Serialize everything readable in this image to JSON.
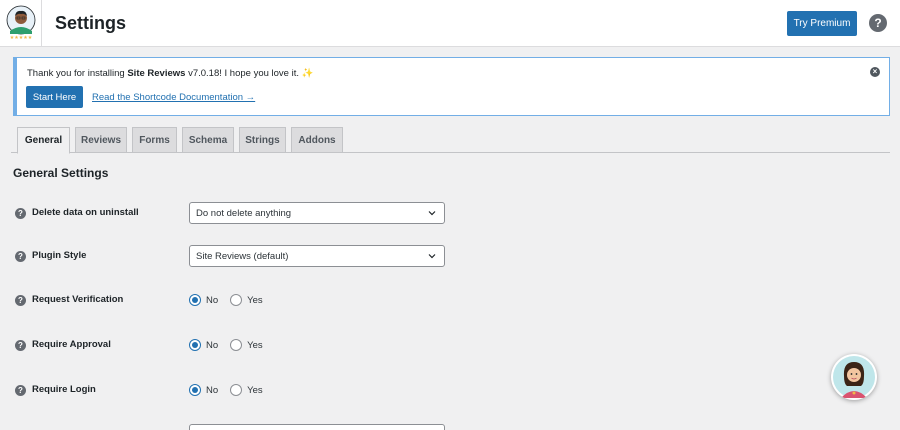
{
  "header": {
    "title": "Settings",
    "premium_label": "Try Premium",
    "help_glyph": "?"
  },
  "notice": {
    "text_prefix": "Thank you for installing ",
    "plugin_name": "Site Reviews",
    "text_suffix": " v7.0.18! I hope you love it. ",
    "sparkle": "✨",
    "start_label": "Start Here",
    "doc_link": "Read the Shortcode Documentation →",
    "close_glyph": "×"
  },
  "tabs": [
    {
      "label": "General",
      "active": true
    },
    {
      "label": "Reviews",
      "active": false
    },
    {
      "label": "Forms",
      "active": false
    },
    {
      "label": "Schema",
      "active": false
    },
    {
      "label": "Strings",
      "active": false
    },
    {
      "label": "Addons",
      "active": false
    }
  ],
  "section": {
    "title": "General Settings"
  },
  "settings": {
    "delete_data": {
      "label": "Delete data on uninstall",
      "value": "Do not delete anything"
    },
    "plugin_style": {
      "label": "Plugin Style",
      "value": "Site Reviews (default)"
    },
    "request_verification": {
      "label": "Request Verification",
      "options": [
        "No",
        "Yes"
      ],
      "selected": "No"
    },
    "require_approval": {
      "label": "Require Approval",
      "options": [
        "No",
        "Yes"
      ],
      "selected": "No"
    },
    "require_login": {
      "label": "Require Login",
      "options": [
        "No",
        "Yes"
      ],
      "selected": "No"
    }
  },
  "colors": {
    "accent": "#2271b1",
    "notice_border": "#72aee6",
    "background": "#f0f0f1"
  },
  "icons": {
    "logo": "reviewer-avatar-logo",
    "help": "help-circle-icon",
    "close": "dismiss-icon",
    "field_help": "question-circle-icon",
    "select": "chevron-down-icon",
    "assistant": "assistant-avatar-icon"
  }
}
